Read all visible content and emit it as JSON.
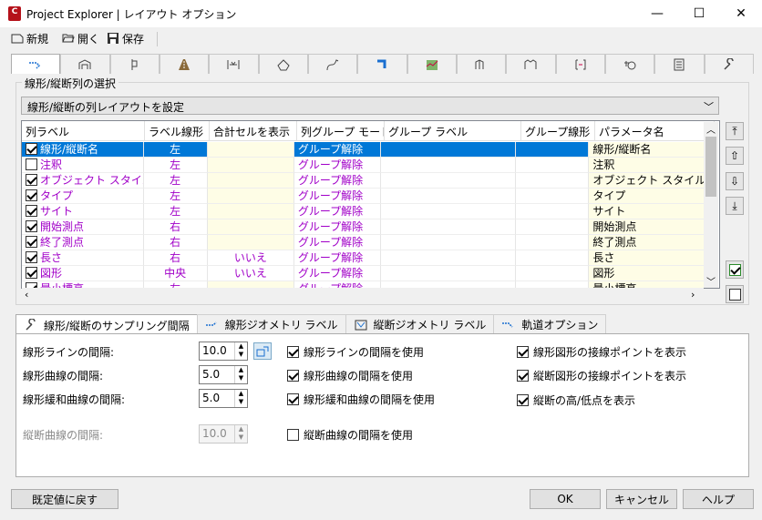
{
  "window": {
    "app_badge": "C",
    "title": "Project Explorer | レイアウト オプション"
  },
  "toolbar": {
    "new_label": "新規",
    "open_label": "開く",
    "save_label": "保存"
  },
  "group": {
    "title": "線形/縦断列の選択",
    "layout_select": "線形/縦断の列レイアウトを設定"
  },
  "grid": {
    "headers": [
      "列ラベル",
      "ラベル線形",
      "合計セルを表示",
      "列グループ モード",
      "グループ ラベル",
      "グループ線形",
      "パラメータ名"
    ],
    "rows": [
      {
        "checked": true,
        "label": "線形/縦断名",
        "align": "左",
        "total": "",
        "mode": "グループ解除",
        "glabel": "",
        "galign": "",
        "param": "線形/縦断名"
      },
      {
        "checked": false,
        "label": "注釈",
        "align": "左",
        "total": "",
        "mode": "グループ解除",
        "glabel": "",
        "galign": "",
        "param": "注釈"
      },
      {
        "checked": true,
        "label": "オブジェクト スタイル",
        "align": "左",
        "total": "",
        "mode": "グループ解除",
        "glabel": "",
        "galign": "",
        "param": "オブジェクト スタイル"
      },
      {
        "checked": true,
        "label": "タイプ",
        "align": "左",
        "total": "",
        "mode": "グループ解除",
        "glabel": "",
        "galign": "",
        "param": "タイプ"
      },
      {
        "checked": true,
        "label": "サイト",
        "align": "左",
        "total": "",
        "mode": "グループ解除",
        "glabel": "",
        "galign": "",
        "param": "サイト"
      },
      {
        "checked": true,
        "label": "開始測点",
        "align": "右",
        "total": "",
        "mode": "グループ解除",
        "glabel": "",
        "galign": "",
        "param": "開始測点"
      },
      {
        "checked": true,
        "label": "終了測点",
        "align": "右",
        "total": "",
        "mode": "グループ解除",
        "glabel": "",
        "galign": "",
        "param": "終了測点"
      },
      {
        "checked": true,
        "label": "長さ",
        "align": "右",
        "total": "いいえ",
        "mode": "グループ解除",
        "glabel": "",
        "galign": "",
        "param": "長さ"
      },
      {
        "checked": true,
        "label": "図形",
        "align": "中央",
        "total": "いいえ",
        "mode": "グループ解除",
        "glabel": "",
        "galign": "",
        "param": "図形"
      },
      {
        "checked": true,
        "label": "最小標高",
        "align": "左",
        "total": "",
        "mode": "グループ解除",
        "glabel": "",
        "galign": "",
        "param": "最小標高"
      }
    ]
  },
  "lower_tabs": [
    "線形/縦断のサンプリング間隔",
    "線形ジオメトリ ラベル",
    "縦断ジオメトリ ラベル",
    "軌道オプション"
  ],
  "sampling": {
    "fields": [
      {
        "label": "線形ラインの間隔:",
        "value": "10.0",
        "enabled": true
      },
      {
        "label": "線形曲線の間隔:",
        "value": "5.0",
        "enabled": true
      },
      {
        "label": "線形緩和曲線の間隔:",
        "value": "5.0",
        "enabled": true
      },
      {
        "label": "縦断曲線の間隔:",
        "value": "10.0",
        "enabled": false
      }
    ],
    "use_checks": [
      {
        "label": "線形ラインの間隔を使用",
        "checked": true
      },
      {
        "label": "線形曲線の間隔を使用",
        "checked": true
      },
      {
        "label": "線形緩和曲線の間隔を使用",
        "checked": true
      },
      {
        "label": "縦断曲線の間隔を使用",
        "checked": false
      }
    ],
    "display_checks": [
      {
        "label": "線形図形の接線ポイントを表示",
        "checked": true
      },
      {
        "label": "縦断図形の接線ポイントを表示",
        "checked": true
      },
      {
        "label": "縦断の高/低点を表示",
        "checked": true
      }
    ]
  },
  "buttons": {
    "reset": "既定値に戻す",
    "ok": "OK",
    "cancel": "キャンセル",
    "help": "ヘルプ"
  },
  "colors": {
    "accent": "#0078d7",
    "link_purple": "#a100c8",
    "cell_yellow": "#fefde6",
    "app_red": "#b5121b"
  }
}
